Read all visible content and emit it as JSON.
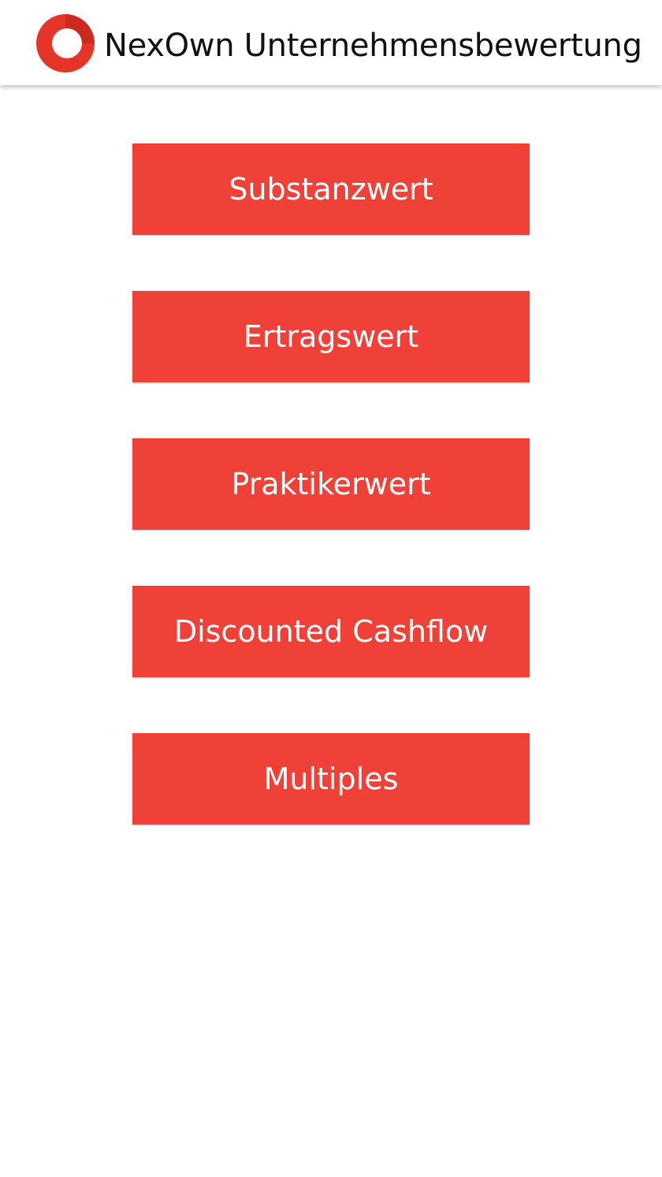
{
  "app": {
    "title": "NexOwn Unternehmensbewertung",
    "logo_icon": "ring-logo-icon"
  },
  "theme": {
    "accent": "#EF4138",
    "logo_red": "#E53528",
    "logo_dark": "#B7201A",
    "background": "#FFFFFF",
    "title_color": "#111111"
  },
  "menu": {
    "items": [
      {
        "label": "Substanzwert"
      },
      {
        "label": "Ertragswert"
      },
      {
        "label": "Praktikerwert"
      },
      {
        "label": "Discounted Cashflow"
      },
      {
        "label": "Multiples"
      }
    ]
  }
}
